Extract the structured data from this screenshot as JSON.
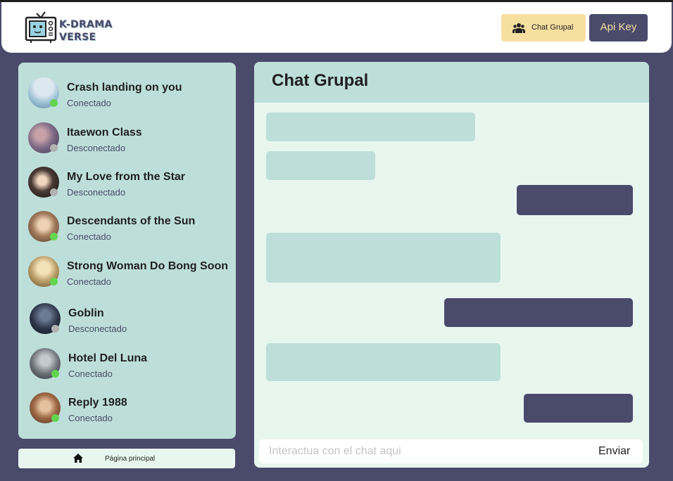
{
  "header": {
    "logo_line1": "K-DRAMA",
    "logo_line2": "VERSE",
    "chat_button_label": "Chat Grupal",
    "chat_button_icon": "users-icon",
    "api_button_label": "Api Key"
  },
  "sidebar": {
    "contacts": [
      {
        "name": "Crash landing on you",
        "status": "Conectado",
        "online": true
      },
      {
        "name": "Itaewon Class",
        "status": "Desconectado",
        "online": false
      },
      {
        "name": "My Love from the Star",
        "status": "Desconectado",
        "online": false
      },
      {
        "name": "Descendants of the Sun",
        "status": "Conectado",
        "online": true
      },
      {
        "name": "Strong Woman Do Bong Soon",
        "status": "Conectado",
        "online": true
      },
      {
        "name": "Goblin",
        "status": "Desconectado",
        "online": false
      },
      {
        "name": "Hotel Del Luna",
        "status": "Conectado",
        "online": true
      },
      {
        "name": "Reply 1988",
        "status": "Conectado",
        "online": true
      }
    ],
    "home_label": "Página principal",
    "home_icon": "home-icon"
  },
  "chat": {
    "title": "Chat Grupal",
    "input_placeholder": "Interactua con el chat aqui",
    "input_value": "",
    "send_label": "Enviar"
  },
  "colors": {
    "background": "#4a4a6b",
    "panel": "#bedfd9",
    "chat_bg": "#e8f6f0",
    "accent_yellow": "#f7dfa0",
    "online": "#63d650",
    "offline": "#b2b2b2"
  }
}
